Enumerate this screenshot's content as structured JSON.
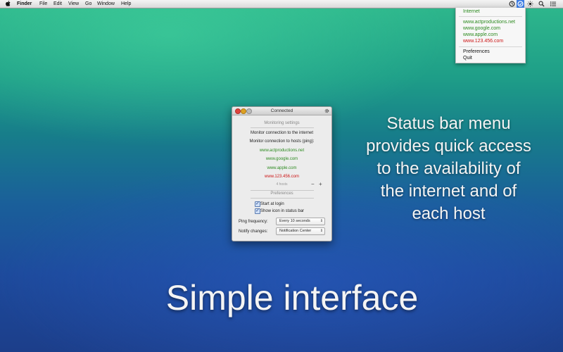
{
  "menubar": {
    "app_name": "Finder",
    "menus": [
      "File",
      "Edit",
      "View",
      "Go",
      "Window",
      "Help"
    ]
  },
  "status_menu": {
    "header": "Internet",
    "hosts": [
      {
        "name": "www.actproductions.net",
        "status_color": "#2c8a1f"
      },
      {
        "name": "www.google.com",
        "status_color": "#2c8a1f"
      },
      {
        "name": "www.apple.com",
        "status_color": "#2c8a1f"
      },
      {
        "name": "www.123.456.com",
        "status_color": "#cc1515"
      }
    ],
    "preferences": "Preferences",
    "quit": "Quit"
  },
  "window": {
    "title": "Connected",
    "monitoring_title": "Monitoring settings",
    "monitor_internet": "Monitor connection to the internet",
    "monitor_hosts": "Monitor connection to hosts (ping):",
    "hosts": [
      "www.actproductions.net",
      "www.google.com",
      "www.apple.com",
      "www.123.456.com"
    ],
    "hosts_count": "4 hosts",
    "remove_label": "−",
    "add_label": "+",
    "preferences_title": "Preferences",
    "start_at_login": "Start at login",
    "show_icon": "Show icon in status bar",
    "ping_label": "Ping frequency:",
    "ping_value": "Every 10 seconds",
    "notify_label": "Notify changes:",
    "notify_value": "Notification Center"
  },
  "promo": {
    "lines": [
      "Status bar menu",
      "provides quick access",
      "to the availability of",
      "the internet and of",
      "each host"
    ]
  },
  "headline": "Simple interface",
  "colors": {
    "ok": "#2c8a1f",
    "fail": "#cc1515",
    "close": "#e0443e",
    "minimize": "#dea123",
    "zoom": "#bcbcbc",
    "highlight": "#3e7de4"
  }
}
